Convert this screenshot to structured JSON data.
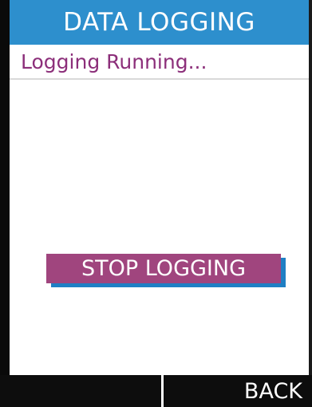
{
  "header": {
    "title": "DATA LOGGING"
  },
  "status": {
    "text": "Logging Running..."
  },
  "actions": {
    "stop_label": "STOP LOGGING"
  },
  "softkeys": {
    "left_label": "",
    "right_label": "BACK"
  },
  "colors": {
    "title_bar": "#2d8fcd",
    "status_text": "#8c2f7a",
    "stop_button": "#a0457e",
    "stop_shadow": "#1f7fc4",
    "softkey_bar": "#0d0d0d"
  }
}
